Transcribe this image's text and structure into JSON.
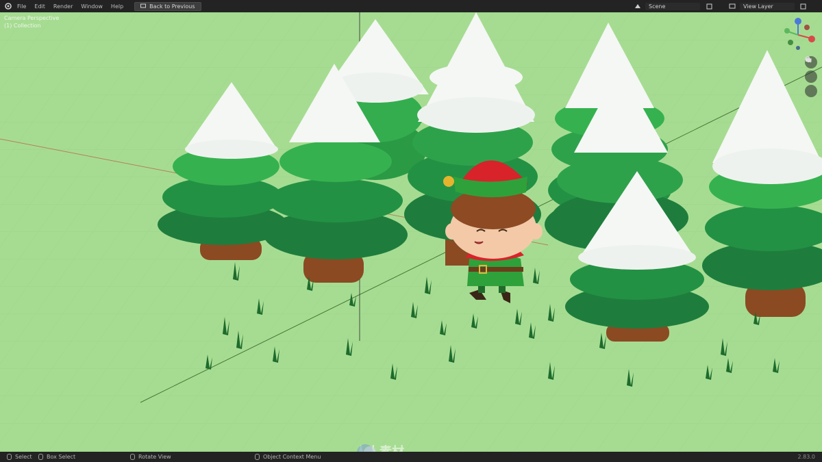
{
  "window": {
    "menu": [
      "File",
      "Edit",
      "Render",
      "Window",
      "Help"
    ],
    "back_button": "Back to Previous",
    "scene_label": "Scene",
    "view_layer_label": "View Layer"
  },
  "viewport": {
    "overlay_line1": "Camera Perspective",
    "overlay_line2": "(1) Collection",
    "watermark": "人人素材"
  },
  "statusbar": {
    "select": "Select",
    "box_select": "Box Select",
    "rotate_view": "Rotate View",
    "context_menu": "Object Context Menu",
    "version": "2.83.0"
  },
  "colors": {
    "ground": "#a6dc92",
    "snow": "#f4f7f4",
    "tree_green_light": "#35b24f",
    "tree_green_dark": "#1e7d3d",
    "trunk": "#8b4a22",
    "elf_red": "#d8232a",
    "elf_green": "#2fa13a"
  },
  "icons": [
    "blender-logo-icon",
    "scene-icon",
    "view-layer-icon",
    "navigation-gizmo-icon",
    "zoom-icon",
    "hand-pan-icon",
    "camera-view-icon",
    "mouse-icon"
  ]
}
